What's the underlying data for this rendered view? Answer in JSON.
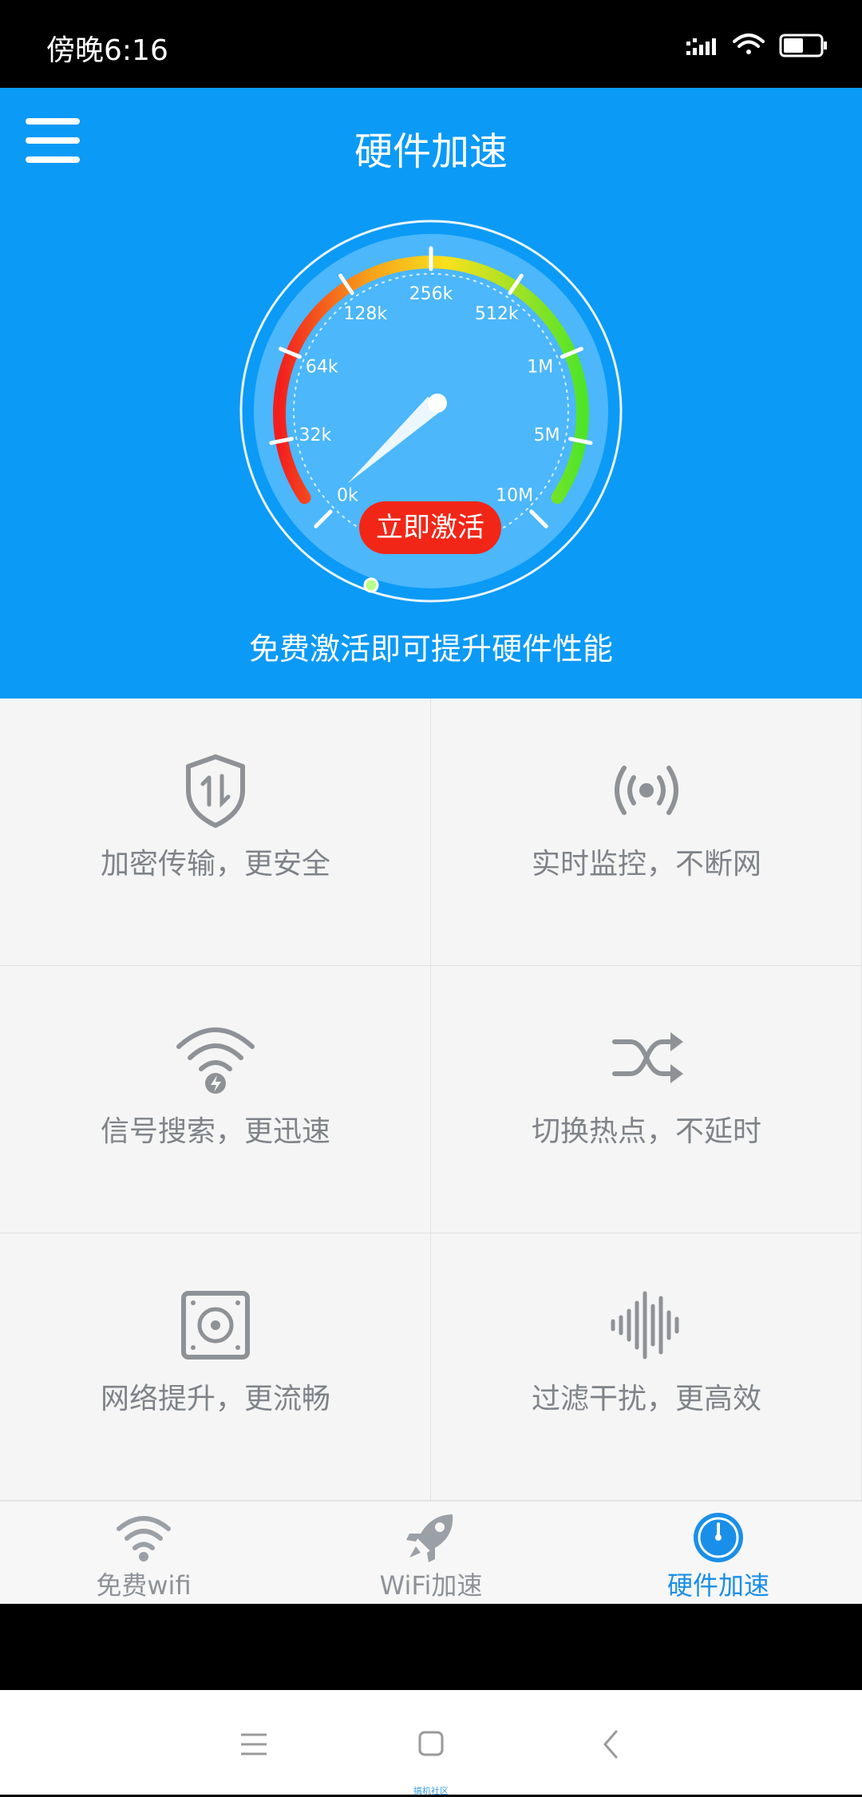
{
  "status_bar": {
    "time": "傍晚6:16"
  },
  "header": {
    "title": "硬件加速"
  },
  "gauge": {
    "ticks": [
      "0k",
      "32k",
      "64k",
      "128k",
      "256k",
      "512k",
      "1M",
      "5M",
      "10M"
    ],
    "button_label": "立即激活"
  },
  "subtitle": "免费激活即可提升硬件性能",
  "features": [
    {
      "label": "加密传输，更安全",
      "icon": "shield-transfer-icon"
    },
    {
      "label": "实时监控，不断网",
      "icon": "broadcast-icon"
    },
    {
      "label": "信号搜索，更迅速",
      "icon": "wifi-bolt-icon"
    },
    {
      "label": "切换热点，不延时",
      "icon": "shuffle-icon"
    },
    {
      "label": "网络提升，更流畅",
      "icon": "speaker-icon"
    },
    {
      "label": "过滤干扰，更高效",
      "icon": "soundwave-icon"
    }
  ],
  "tabs": [
    {
      "label": "免费wifi",
      "icon": "wifi-icon",
      "active": false
    },
    {
      "label": "WiFi加速",
      "icon": "rocket-icon",
      "active": false
    },
    {
      "label": "硬件加速",
      "icon": "speedometer-icon",
      "active": true
    }
  ],
  "watermark": "搞机社区",
  "colors": {
    "primary": "#0b9af6",
    "button_red": "#f22617",
    "tab_active": "#1a8fe9",
    "icon_gray": "#8e9297"
  }
}
